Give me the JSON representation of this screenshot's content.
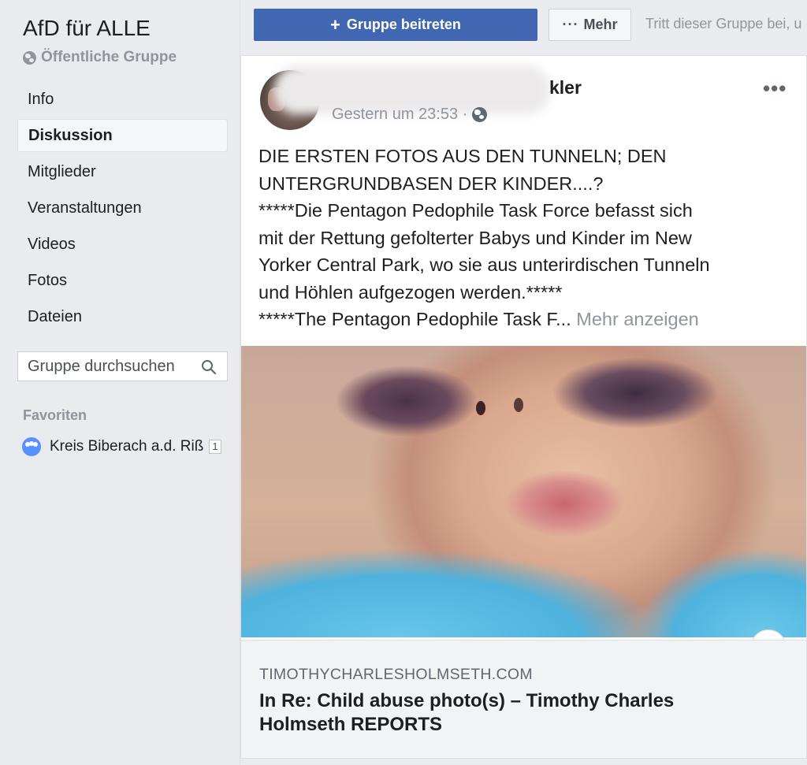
{
  "sidebar": {
    "group_name": "AfD für ALLE",
    "group_type": "Öffentliche Gruppe",
    "nav": [
      {
        "label": "Info",
        "active": false
      },
      {
        "label": "Diskussion",
        "active": true
      },
      {
        "label": "Mitglieder",
        "active": false
      },
      {
        "label": "Veranstaltungen",
        "active": false
      },
      {
        "label": "Videos",
        "active": false
      },
      {
        "label": "Fotos",
        "active": false
      },
      {
        "label": "Dateien",
        "active": false
      }
    ],
    "search_placeholder": "Gruppe durchsuchen",
    "favorites_header": "Favoriten",
    "favorite": {
      "label": "Kreis Biberach a.d. Riß",
      "badge": "1"
    }
  },
  "topbar": {
    "join_label": "Gruppe beitreten",
    "more_label": "Mehr",
    "hint": "Tritt dieser Gruppe bei, u"
  },
  "post": {
    "author_visible": "kler",
    "timestamp": "Gestern um 23:53 ·",
    "menu": "•••",
    "lines": [
      "DIE ERSTEN FOTOS AUS DEN TUNNELN; DEN",
      "UNTERGRUNDBASEN DER KINDER....?",
      "*****Die Pentagon Pedophile Task Force befasst sich",
      "mit der Rettung gefolterter Babys und Kinder im New",
      "Yorker Central Park, wo sie aus unterirdischen Tunneln",
      "und Höhlen aufgezogen werden.*****",
      "*****The Pentagon Pedophile Task F..."
    ],
    "see_more": "Mehr anzeigen",
    "link": {
      "domain": "TIMOTHYCHARLESHOLMSETH.COM",
      "title": "In Re: Child abuse photo(s) – Timothy Charles Holmseth REPORTS",
      "info_icon": "i"
    }
  },
  "icons": {
    "globe": "globe-icon",
    "search": "search-icon",
    "group": "group-icon",
    "plus": "plus-icon",
    "more": "more-dots-icon",
    "info": "info-icon"
  },
  "colors": {
    "brand": "#4267b2",
    "background": "#e9ebee",
    "muted": "#90949c"
  }
}
